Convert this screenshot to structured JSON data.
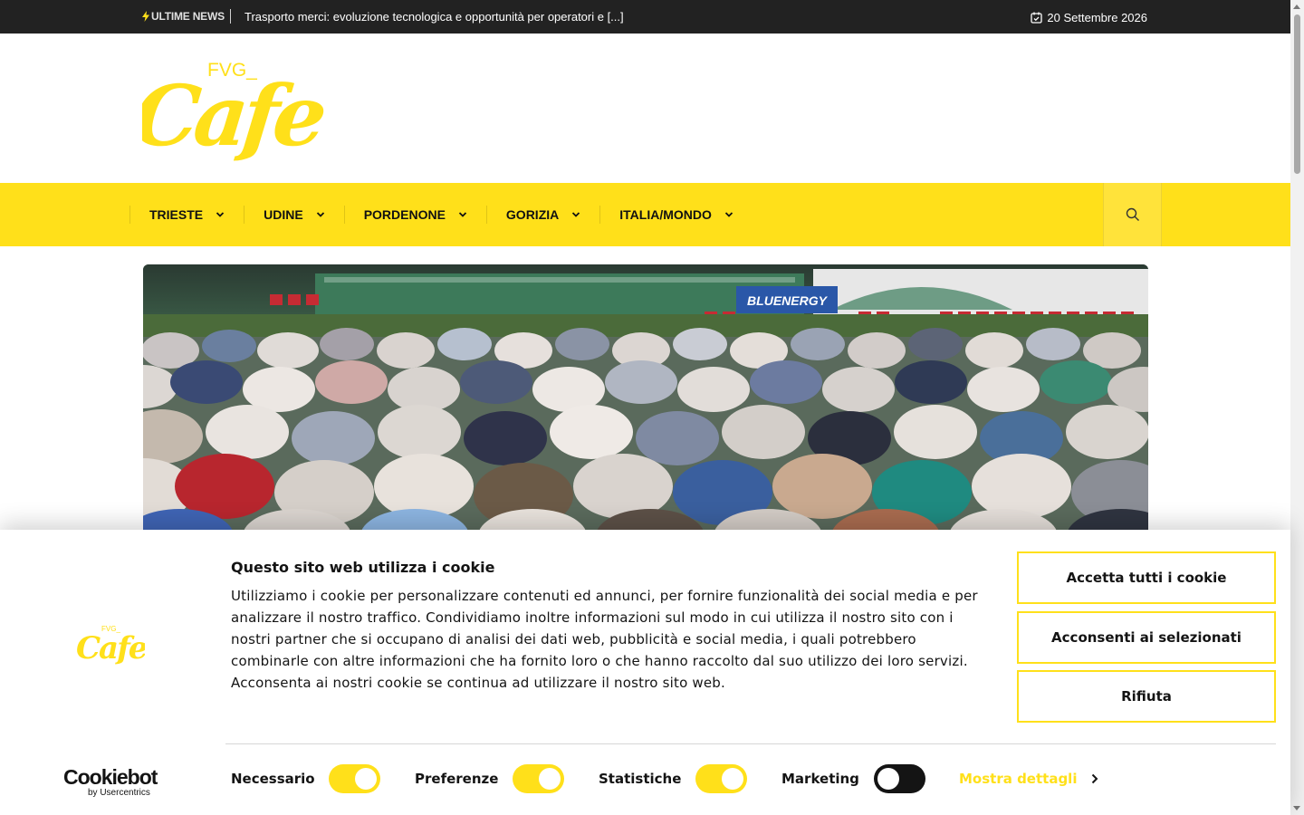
{
  "topbar": {
    "breaking_label": "ULTIME NEWS",
    "ticker_text": "Trasporto merci: evoluzione tecnologica e opportunità per operatori e [...]",
    "date": "20 Settembre 2026"
  },
  "brand": {
    "logo_small_text": "FVG_",
    "logo_main_text": "Cafe",
    "color": "#ffe01a"
  },
  "nav": {
    "items": [
      {
        "label": "TRIESTE"
      },
      {
        "label": "UDINE"
      },
      {
        "label": "PORDENONE"
      },
      {
        "label": "GORIZIA"
      },
      {
        "label": "ITALIA/MONDO"
      }
    ]
  },
  "hero": {
    "banner_text": "BLUENERGY"
  },
  "cookie": {
    "title": "Questo sito web utilizza i cookie",
    "body": "Utilizziamo i cookie per personalizzare contenuti ed annunci, per fornire funzionalità dei social media e per analizzare il nostro traffico. Condividiamo inoltre informazioni sul modo in cui utilizza il nostro sito con i nostri partner che si occupano di analisi dei dati web, pubblicità e social media, i quali potrebbero combinarle con altre informazioni che ha fornito loro o che hanno raccolto dal suo utilizzo dei loro servizi. Acconsenta ai nostri cookie se continua ad utilizzare il nostro sito web.",
    "buttons": {
      "accept_all": "Accetta tutti i cookie",
      "accept_selected": "Acconsenti ai selezionati",
      "reject": "Rifiuta"
    },
    "toggles": [
      {
        "label": "Necessario",
        "on": true
      },
      {
        "label": "Preferenze",
        "on": true
      },
      {
        "label": "Statistiche",
        "on": true
      },
      {
        "label": "Marketing",
        "on": false
      }
    ],
    "details_link": "Mostra dettagli",
    "provider": "Cookiebot",
    "provider_sub": "by Usercentrics"
  }
}
